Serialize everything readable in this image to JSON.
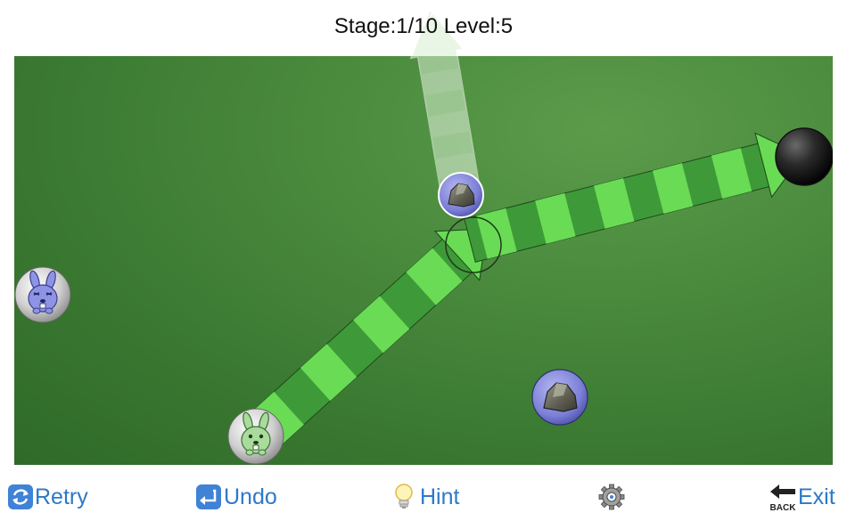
{
  "header": {
    "stage_level": "Stage:1/10 Level:5"
  },
  "board": {
    "colors": {
      "board_green": "#4a8a3d",
      "arrow_light": "#6adb55",
      "arrow_dark": "#3e9a38",
      "ghost_arrow": "#cfe8c8",
      "ring_purple": "#7b7fd6"
    },
    "pieces": [
      {
        "name": "purple-rabbit",
        "icon": "purple-rabbit-icon"
      },
      {
        "name": "green-rabbit",
        "icon": "green-rabbit-icon"
      },
      {
        "name": "rock-center",
        "icon": "rock-icon"
      },
      {
        "name": "rock-lower",
        "icon": "rock-icon"
      },
      {
        "name": "black-hole",
        "icon": "hole-icon"
      }
    ]
  },
  "toolbar": {
    "retry_label": "Retry",
    "undo_label": "Undo",
    "hint_label": "Hint",
    "settings_icon": "gear-icon",
    "exit_label": "Exit",
    "back_text": "BACK"
  }
}
